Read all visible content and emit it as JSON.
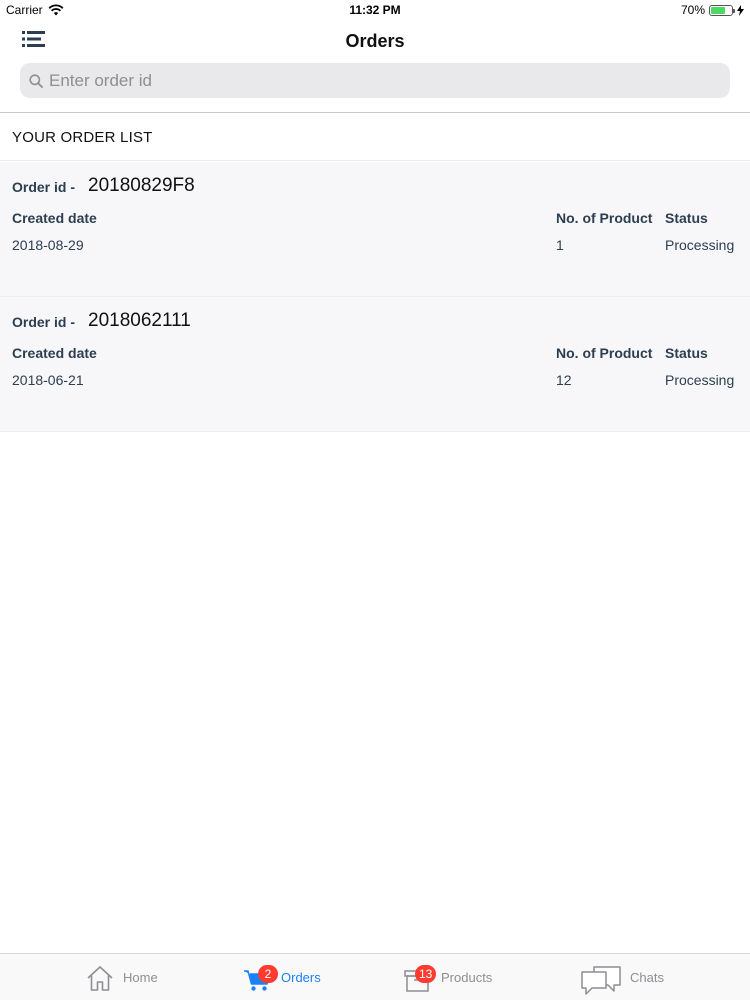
{
  "status_bar": {
    "carrier": "Carrier",
    "time": "11:32 PM",
    "battery": "70%",
    "battery_level": 0.7
  },
  "nav": {
    "title": "Orders"
  },
  "search": {
    "placeholder": "Enter order id",
    "value": ""
  },
  "section": {
    "title": "YOUR ORDER LIST"
  },
  "orders": [
    {
      "id_label": "Order id -",
      "id": "20180829F8",
      "created_label": "Created date",
      "created": "2018-08-29",
      "count_label": "No. of Product",
      "count": "1",
      "status_label": "Status",
      "status": "Processing"
    },
    {
      "id_label": "Order id -",
      "id": "2018062111",
      "created_label": "Created date",
      "created": "2018-06-21",
      "count_label": "No. of Product",
      "count": "12",
      "status_label": "Status",
      "status": "Processing"
    }
  ],
  "tabs": [
    {
      "label": "Home",
      "icon": "home-icon",
      "badge": ""
    },
    {
      "label": "Orders",
      "icon": "cart-icon",
      "badge": "2"
    },
    {
      "label": "Products",
      "icon": "box-icon",
      "badge": "13"
    },
    {
      "label": "Chats",
      "icon": "chat-icon",
      "badge": ""
    }
  ],
  "colors": {
    "accent": "#1a82f7",
    "badge": "#ff3b30",
    "inactive": "#8e8e93"
  }
}
